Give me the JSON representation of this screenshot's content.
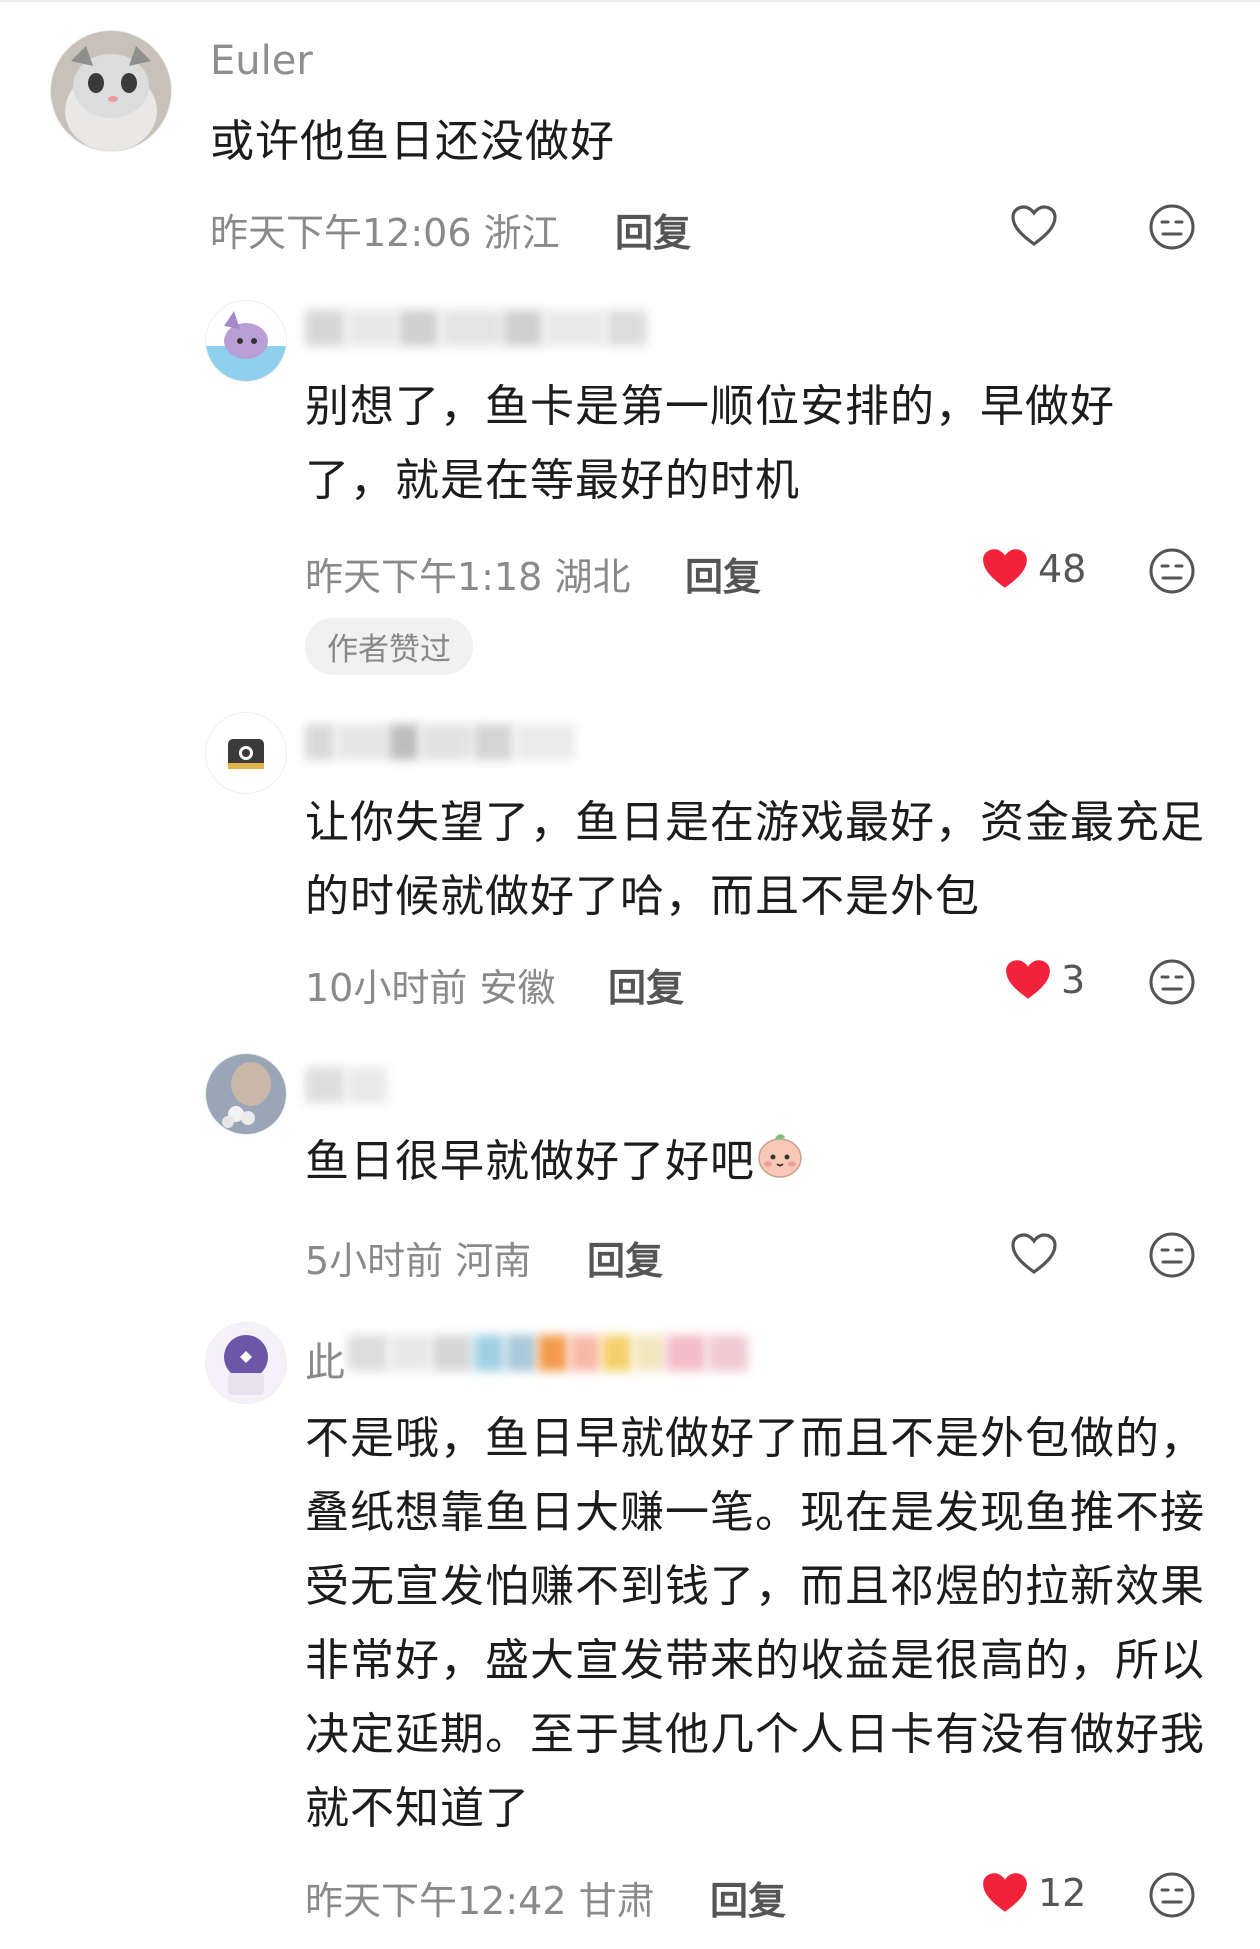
{
  "comments": [
    {
      "username": "Euler",
      "text": "或许他鱼日还没做好",
      "time": "昨天下午12:06",
      "location": "浙江",
      "reply_label": "回复",
      "likes": "",
      "liked": false
    },
    {
      "username": "",
      "text": "别想了，鱼卡是第一顺位安排的，早做好了，就是在等最好的时机",
      "time": "昨天下午1:18",
      "location": "湖北",
      "reply_label": "回复",
      "likes": "48",
      "liked": true,
      "badge": "作者赞过"
    },
    {
      "username": "",
      "text": "让你失望了，鱼日是在游戏最好，资金最充足的时候就做好了哈，而且不是外包",
      "time": "10小时前",
      "location": "安徽",
      "reply_label": "回复",
      "likes": "3",
      "liked": true
    },
    {
      "username": "",
      "text": "鱼日很早就做好了好吧",
      "time": "5小时前",
      "location": "河南",
      "reply_label": "回复",
      "likes": "",
      "liked": false
    },
    {
      "username": "此",
      "text": "不是哦，鱼日早就做好了而且不是外包做的，叠纸想靠鱼日大赚一笔。现在是发现鱼推不接受无宣发怕赚不到钱了，而且祁煜的拉新效果非常好，盛大宣发带来的收益是很高的，所以决定延期。至于其他几个人日卡有没有做好我就不知道了",
      "time": "昨天下午12:42",
      "location": "甘肃",
      "reply_label": "回复",
      "likes": "12",
      "liked": true
    }
  ],
  "colors": {
    "like_red": "#f0233b",
    "meta_gray": "#8a8a8a",
    "text": "#1c1c1c"
  },
  "icons": [
    "heart-outline-icon",
    "heart-filled-icon",
    "dislike-face-icon",
    "peach-emoji-icon"
  ]
}
